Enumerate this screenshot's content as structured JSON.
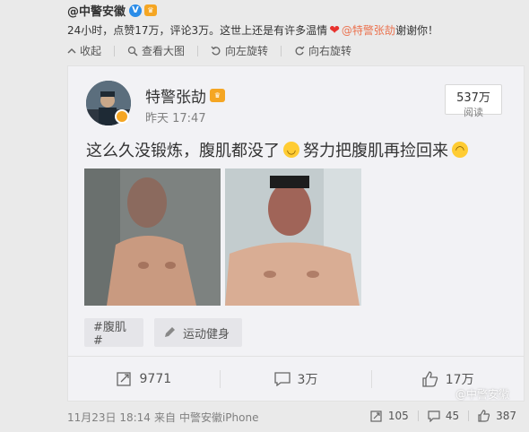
{
  "repost": {
    "author": "@中警安徽",
    "comment_pre": "24小时，点赞17万，评论3万。这世上还是有许多温情",
    "mention": "@特警张劼",
    "comment_post": " 谢谢你！"
  },
  "toolbar": {
    "collapse": "收起",
    "view_large": "查看大图",
    "rotate_left": "向左旋转",
    "rotate_right": "向右旋转"
  },
  "card": {
    "name": "特警张劼",
    "time": "昨天 17:47",
    "views_count": "537万",
    "views_label": "阅读",
    "text_part1": "这么久没锻炼，腹肌都没了",
    "text_part2": "努力把腹肌再捡回来",
    "tags": [
      "#腹肌#",
      "运动健身"
    ],
    "actions": {
      "repost": "9771",
      "comment": "3万",
      "like": "17万"
    }
  },
  "footer": {
    "time": "11月23日 18:14",
    "source_prefix": "来自",
    "source": "中警安徽iPhone",
    "repost": "105",
    "comment": "45",
    "like": "387"
  },
  "watermark": "@中警安徽",
  "colors": {
    "accent": "#eb7350",
    "verified": "#2a8ce8",
    "crown": "#f5a623"
  }
}
